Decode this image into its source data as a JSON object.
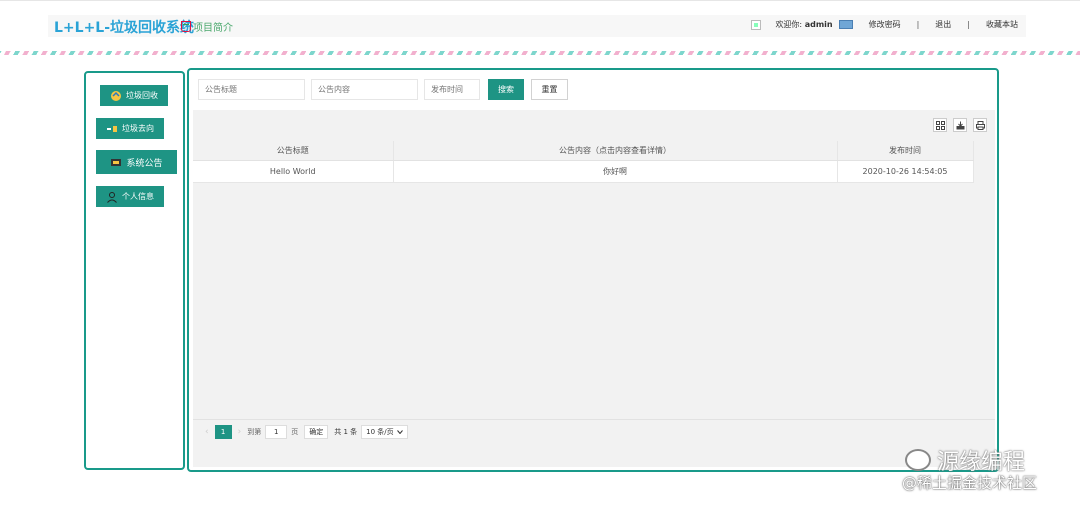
{
  "header": {
    "logo": "L+L+L-垃圾回收系统",
    "intro": "项目简介",
    "welcome_prefix": "欢迎你:",
    "username": "admin",
    "change_password": "修改密码",
    "separator": "|",
    "logout": "退出",
    "bookmark": "收藏本站"
  },
  "sidebar": {
    "items": [
      {
        "label": "垃圾回收",
        "icon": "recycle-icon"
      },
      {
        "label": "垃圾去向",
        "icon": "truck-icon"
      },
      {
        "label": "系统公告",
        "icon": "announcement-icon"
      },
      {
        "label": "个人信息",
        "icon": "user-icon"
      }
    ]
  },
  "search": {
    "title_placeholder": "公告标题",
    "content_placeholder": "公告内容",
    "time_placeholder": "发布时间",
    "search_label": "搜索",
    "reset_label": "重置"
  },
  "table": {
    "columns": [
      "公告标题",
      "公告内容（点击内容查看详情）",
      "发布时间"
    ],
    "rows": [
      [
        "Hello World",
        "你好啊",
        "2020-10-26 14:54:05"
      ]
    ]
  },
  "pagination": {
    "prev": "‹",
    "current_page": "1",
    "next": "›",
    "goto_label": "到第",
    "goto_value": "1",
    "page_unit": "页",
    "confirm": "确定",
    "total": "共 1 条",
    "page_size": "10 条/页"
  },
  "watermark": {
    "line1": "源缘编程",
    "line2": "@稀土掘金技术社区"
  },
  "colors": {
    "accent": "#1e9484",
    "logo": "#2aa3d6"
  }
}
